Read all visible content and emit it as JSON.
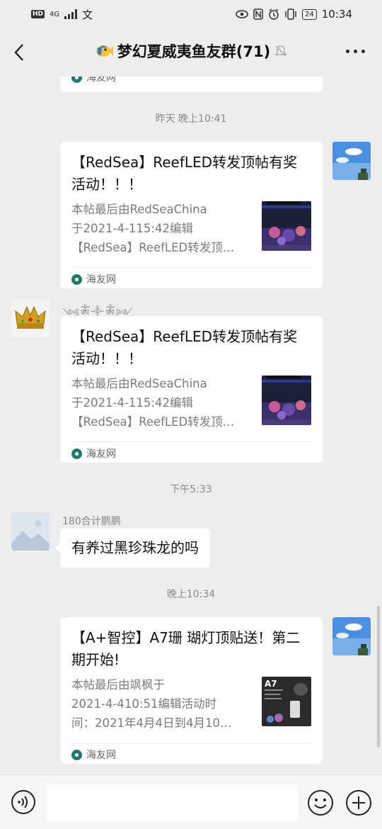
{
  "status_bar": {
    "hd": "HD",
    "network": "4G",
    "ime": "文",
    "battery": "24",
    "time": "10:34"
  },
  "header": {
    "title": "梦幻夏威夷鱼友群(71)"
  },
  "messages": {
    "top_card": {
      "source": "海友网"
    },
    "ts1": "昨天 晚上10:41",
    "card1": {
      "title": "【RedSea】ReefLED转发顶帖有奖活动！！！",
      "desc_line1": "本帖最后由RedSeaChina",
      "desc_line2": "于2021-4-115:42编辑",
      "desc_line3": "【RedSea】ReefLED转发顶…",
      "source": "海友网"
    },
    "card2": {
      "sender": "༺ༀ༒ༀ༻",
      "title": "【RedSea】ReefLED转发顶帖有奖活动！！！",
      "desc_line1": "本帖最后由RedSeaChina",
      "desc_line2": "于2021-4-115:42编辑",
      "desc_line3": "【RedSea】ReefLED转发顶…",
      "source": "海友网"
    },
    "ts2": "下午5:33",
    "msg3": {
      "sender": "180合计鹏鹏",
      "text": "有养过黑珍珠龙的吗"
    },
    "ts3": "晚上10:34",
    "card4": {
      "title": "【A+智控】A7珊 瑚灯顶贴送！第二期开始!",
      "desc_line1": "本帖最后由飒枫于",
      "desc_line2": "2021-4-410:51编辑活动时",
      "desc_line3": "间：2021年4月4日到4月10…",
      "thumb_label": "A7",
      "source": "海友网"
    }
  },
  "colors": {
    "background": "#ededed",
    "card": "#ffffff",
    "source_icon": "#1f7a6d"
  }
}
